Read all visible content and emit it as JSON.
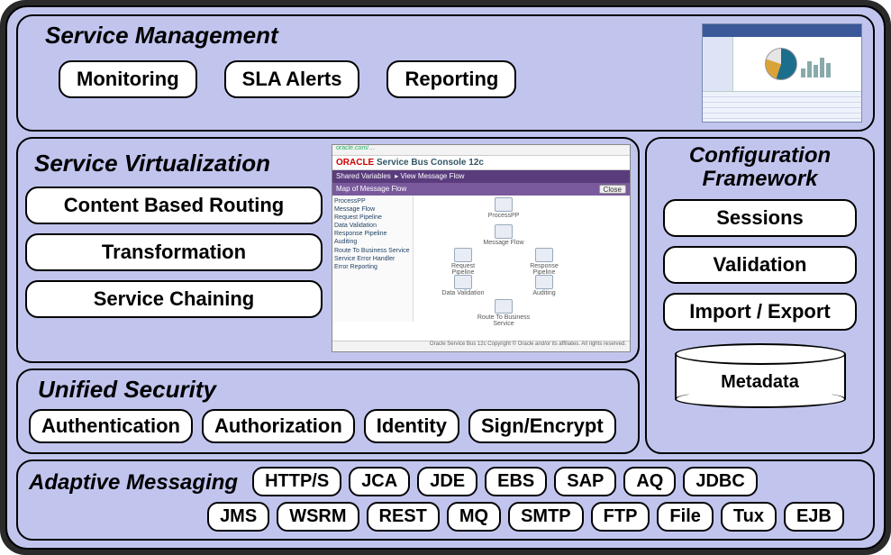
{
  "service_management": {
    "title": "Service Management",
    "items": [
      "Monitoring",
      "SLA Alerts",
      "Reporting"
    ]
  },
  "service_virtualization": {
    "title": "Service Virtualization",
    "items": [
      "Content Based Routing",
      "Transformation",
      "Service Chaining"
    ],
    "console": {
      "brand_left": "ORACLE",
      "brand_right": "Service Bus Console 12c",
      "bar1": "Shared Variables",
      "bar2_left": "Map of Message Flow",
      "bar2_btn": "Close",
      "view_label": "View Message Flow",
      "tree": [
        "ProcessPP",
        "  Message Flow",
        "  Request Pipeline",
        "    Data Validation",
        "  Response Pipeline",
        "    Auditing",
        "  Route To Business Service",
        "  Service Error Handler",
        "    Error Reporting"
      ],
      "nodes": {
        "top": "ProcessPP",
        "mid": "Message Flow",
        "left": "Request Pipeline",
        "right": "Response Pipeline",
        "bl": "Data Validation",
        "br": "Auditing",
        "bottom": "Route To Business Service"
      }
    }
  },
  "configuration_framework": {
    "title_line1": "Configuration",
    "title_line2": "Framework",
    "items": [
      "Sessions",
      "Validation",
      "Import / Export"
    ],
    "cylinder": "Metadata"
  },
  "unified_security": {
    "title": "Unified Security",
    "items": [
      "Authentication",
      "Authorization",
      "Identity",
      "Sign/Encrypt"
    ]
  },
  "adaptive_messaging": {
    "title": "Adaptive Messaging",
    "row1": [
      "HTTP/S",
      "JCA",
      "JDE",
      "EBS",
      "SAP",
      "AQ",
      "JDBC"
    ],
    "row2": [
      "JMS",
      "WSRM",
      "REST",
      "MQ",
      "SMTP",
      "FTP",
      "File",
      "Tux",
      "EJB"
    ]
  }
}
